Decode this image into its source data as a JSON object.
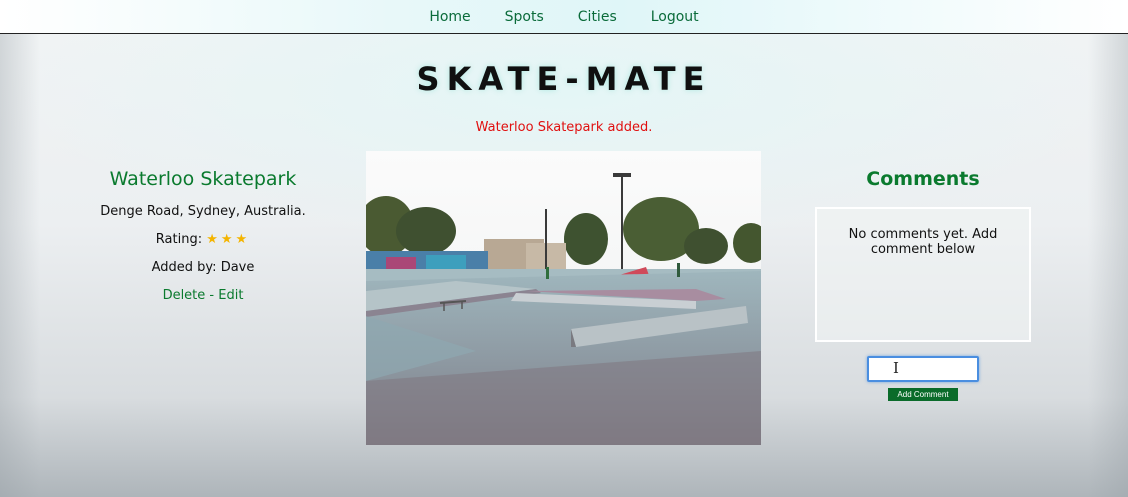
{
  "nav": {
    "items": [
      {
        "label": "Home"
      },
      {
        "label": "Spots"
      },
      {
        "label": "Cities"
      },
      {
        "label": "Logout"
      }
    ]
  },
  "site": {
    "title": "SKATE-MATE"
  },
  "flash": {
    "message": "Waterloo Skatepark added."
  },
  "spot": {
    "name": "Waterloo Skatepark",
    "address": "Denge Road, Sydney, Australia.",
    "rating_label": "Rating:",
    "rating_stars": "★★★",
    "rating_value": 3,
    "added_by": "Added by: Dave",
    "delete_label": "Delete",
    "separator": " - ",
    "edit_label": "Edit"
  },
  "comments": {
    "heading": "Comments",
    "empty_message": "No comments yet. Add comment below",
    "input_value": "",
    "add_button_label": "Add Comment"
  },
  "colors": {
    "accent_green": "#0a7a2e",
    "flash_red": "#e01010",
    "star_gold": "#f4b400",
    "button_green": "#0a6b2a"
  },
  "icons": {
    "cursor": "text-cursor-icon",
    "star": "star-icon"
  }
}
